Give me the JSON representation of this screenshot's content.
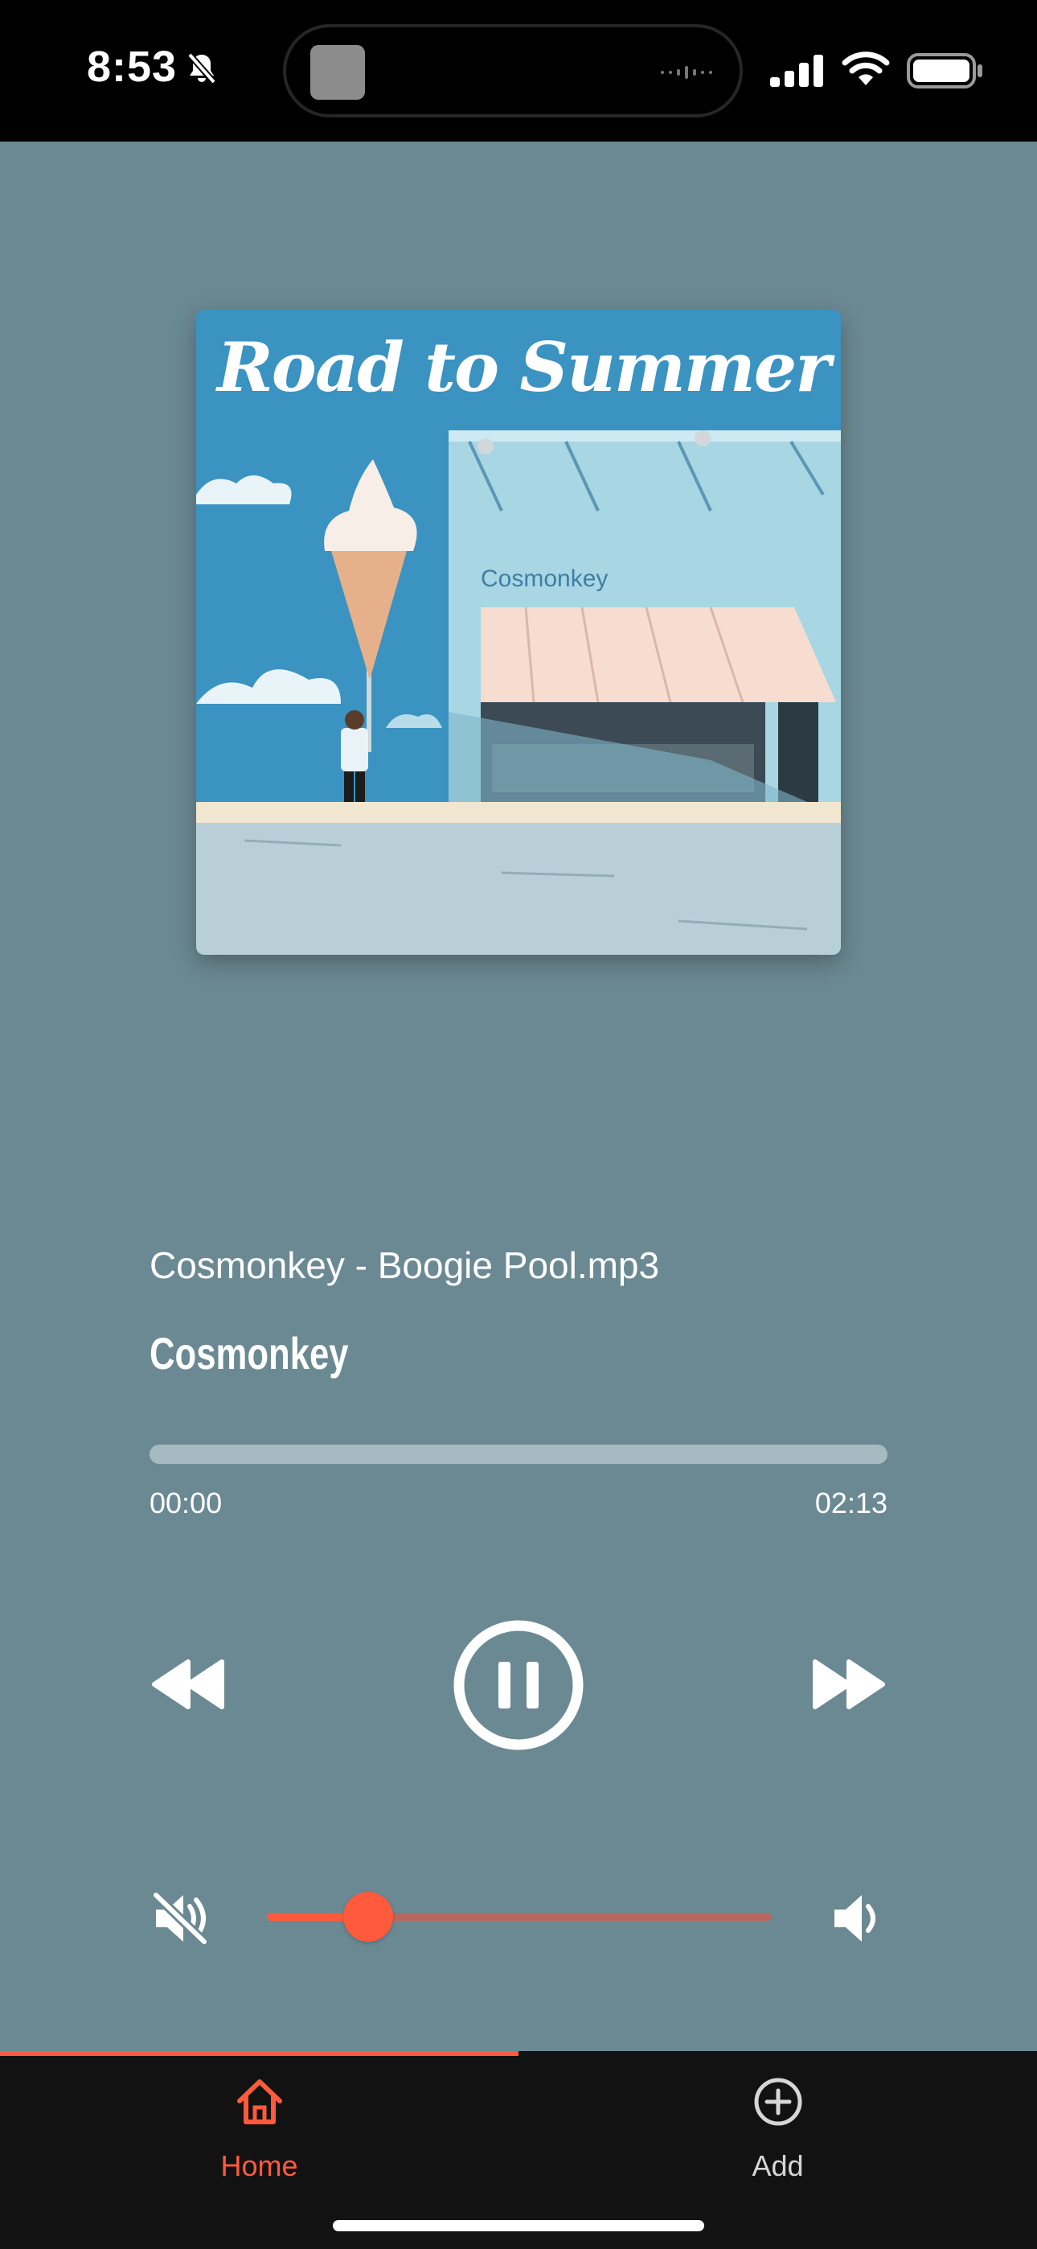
{
  "status_bar": {
    "time": "8:53",
    "icons": [
      "bell-slash-icon",
      "signal-icon",
      "wifi-icon",
      "battery-icon"
    ]
  },
  "album": {
    "art_title": "Road to Summer",
    "shop_sign": "Cosmonkey"
  },
  "track": {
    "file_name": "Cosmonkey - Boogie Pool.mp3",
    "artist": "Cosmonkey"
  },
  "playback": {
    "elapsed": "00:00",
    "total": "02:13",
    "progress": 0,
    "is_playing": true
  },
  "volume": {
    "level": 0.2
  },
  "tabs": [
    {
      "label": "Home",
      "icon": "home-icon",
      "active": true
    },
    {
      "label": "Add",
      "icon": "add-circle-icon",
      "active": false
    }
  ],
  "colors": {
    "background": "#6b8993",
    "accent": "#ff5a3c",
    "tab_bar": "#121212",
    "progress_track": "#a6b9c0"
  }
}
